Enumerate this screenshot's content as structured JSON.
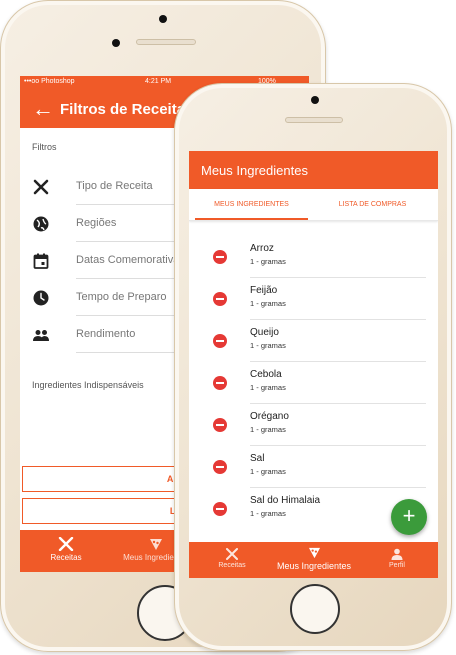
{
  "back_phone": {
    "status_bar": {
      "carrier": "•••oo Photoshop",
      "time": "4:21 PM",
      "battery": "100%"
    },
    "app_bar": {
      "title": "Filtros de Receitas",
      "back_icon": "arrow-left-icon"
    },
    "section_filters": "Filtros",
    "filters": [
      {
        "label": "Tipo de Receita",
        "icon": "fork-knife-icon"
      },
      {
        "label": "Regiões",
        "icon": "globe-icon"
      },
      {
        "label": "Datas Comemorativas",
        "icon": "calendar-icon"
      },
      {
        "label": "Tempo de Preparo",
        "icon": "clock-icon"
      },
      {
        "label": "Rendimento",
        "icon": "people-icon"
      }
    ],
    "section_ingredients": "Ingredientes Indispensáveis",
    "apply_button": "APLICAR FILTROS",
    "clear_button": "LIMPAR FILTROS",
    "bottom_nav": [
      {
        "label": "Receitas",
        "icon": "fork-knife-icon"
      },
      {
        "label": "Meus Ingredientes",
        "icon": "pizza-icon"
      }
    ]
  },
  "front_phone": {
    "app_bar": {
      "title": "Meus Ingredientes"
    },
    "tabs": [
      {
        "label": "MEUS INGREDIENTES",
        "active": true
      },
      {
        "label": "LISTA DE COMPRAS",
        "active": false
      }
    ],
    "ingredients": [
      {
        "name": "Arroz",
        "qty": "1 - gramas"
      },
      {
        "name": "Feijão",
        "qty": "1 - gramas"
      },
      {
        "name": "Queijo",
        "qty": "1 - gramas"
      },
      {
        "name": "Cebola",
        "qty": "1 - gramas"
      },
      {
        "name": "Orégano",
        "qty": "1 - gramas"
      },
      {
        "name": "Sal",
        "qty": "1 - gramas"
      },
      {
        "name": "Sal do Himalaia",
        "qty": "1 - gramas"
      }
    ],
    "fab": "+",
    "bottom_nav": [
      {
        "label": "Receitas",
        "icon": "fork-knife-icon"
      },
      {
        "label": "Meus Ingredientes",
        "icon": "pizza-icon"
      },
      {
        "label": "Perfil",
        "icon": "person-icon"
      }
    ]
  },
  "colors": {
    "accent": "#f05a28",
    "remove": "#e53935",
    "fab": "#3b9b3b"
  }
}
